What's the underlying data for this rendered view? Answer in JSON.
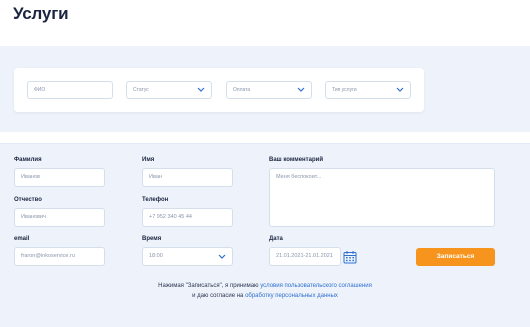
{
  "page": {
    "title": "Услуги"
  },
  "filters": {
    "name_placeholder": "ФИО",
    "status": "Статус",
    "payment": "Оплата",
    "service_type": "Тип услуги"
  },
  "form": {
    "lastname": {
      "label": "Фамилия",
      "value": "Иванов"
    },
    "firstname": {
      "label": "Имя",
      "value": "Иван"
    },
    "comment": {
      "label": "Ваш комментарий",
      "placeholder": "Меня беспокоит..."
    },
    "patronymic": {
      "label": "Отчество",
      "value": "Иванович"
    },
    "phone": {
      "label": "Телефон",
      "value": "+7 952 340 45 44"
    },
    "email": {
      "label": "email",
      "value": "fraron@inkoservice.ru"
    },
    "time": {
      "label": "Время",
      "value": "18:00"
    },
    "date": {
      "label": "Дата",
      "value": "21.01.2021-21.01.2021"
    },
    "submit_label": "Записаться"
  },
  "consent": {
    "line1_prefix": "Нажимая \"Записаться\", я принимаю",
    "terms_link": "условия пользовательского соглашения",
    "line2_prefix": "и даю согласие на",
    "privacy_link": "обработку персональных данных"
  },
  "colors": {
    "accent": "#f7941d",
    "band": "#eef3fb",
    "link": "#2f6fd0"
  }
}
